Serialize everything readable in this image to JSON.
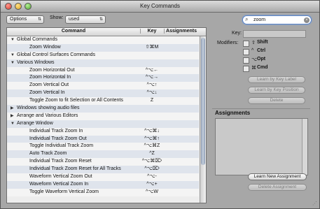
{
  "window": {
    "title": "Key Commands"
  },
  "toolbar": {
    "options_label": "Options",
    "show_label": "Show:",
    "show_value": "used",
    "search_value": "zoom"
  },
  "table": {
    "headers": {
      "command": "Command",
      "key": "Key",
      "assignments": "Assignments"
    },
    "rows": [
      {
        "label": "Global Commands",
        "level": 0,
        "expanded": true,
        "key": ""
      },
      {
        "label": "Zoom Window",
        "level": 1,
        "key": "⇧⌘M"
      },
      {
        "label": "Global Control Surfaces Commands",
        "level": 0,
        "expanded": true,
        "key": ""
      },
      {
        "label": "Various Windows",
        "level": 0,
        "expanded": true,
        "key": ""
      },
      {
        "label": "Zoom Horizontal Out",
        "level": 1,
        "key": "^⌥←"
      },
      {
        "label": "Zoom Horizontal In",
        "level": 1,
        "key": "^⌥→"
      },
      {
        "label": "Zoom Vertical Out",
        "level": 1,
        "key": "^⌥↑"
      },
      {
        "label": "Zoom Vertical In",
        "level": 1,
        "key": "^⌥↓"
      },
      {
        "label": "Toggle Zoom to fit Selection or All Contents",
        "level": 1,
        "key": "Z"
      },
      {
        "label": "Windows showing audio files",
        "level": 0,
        "expanded": false,
        "key": ""
      },
      {
        "label": "Arrange and Various Editors",
        "level": 0,
        "expanded": false,
        "key": ""
      },
      {
        "label": "Arrange Window",
        "level": 0,
        "expanded": true,
        "key": ""
      },
      {
        "label": "Individual Track Zoom In",
        "level": 1,
        "key": "^⌥⌘↓"
      },
      {
        "label": "Individual Track Zoom Out",
        "level": 1,
        "key": "^⌥⌘↑"
      },
      {
        "label": "Toggle Individual Track Zoom",
        "level": 1,
        "key": "^⌥⌘Z"
      },
      {
        "label": "Auto Track Zoom",
        "level": 1,
        "key": "^Z"
      },
      {
        "label": "Individual Track Zoom Reset",
        "level": 1,
        "key": "^⌥⌘⌦"
      },
      {
        "label": "Individual Track Zoom Reset for All Tracks",
        "level": 1,
        "key": "^⌥⌦"
      },
      {
        "label": "Waveform Vertical Zoom Out",
        "level": 1,
        "key": "^⌥-"
      },
      {
        "label": "Waveform Vertical Zoom In",
        "level": 1,
        "key": "^⌥+"
      },
      {
        "label": "Toggle Waveform Vertical Zoom",
        "level": 1,
        "key": "^⌥W"
      }
    ]
  },
  "inspector": {
    "key_label": "Key:",
    "modifiers_label": "Modifiers:",
    "modifiers": [
      {
        "symbol": "⇧",
        "name": "Shift"
      },
      {
        "symbol": "^",
        "name": "Ctrl"
      },
      {
        "symbol": "⌥",
        "name": "Opt"
      },
      {
        "symbol": "⌘",
        "name": "Cmd"
      }
    ],
    "learn_by_label": "Learn by Key Label",
    "learn_by_position": "Learn by Key Position",
    "delete": "Delete",
    "assignments_title": "Assignments",
    "learn_new_assignment": "Learn New Assignment",
    "delete_assignment": "Delete Assignment"
  }
}
